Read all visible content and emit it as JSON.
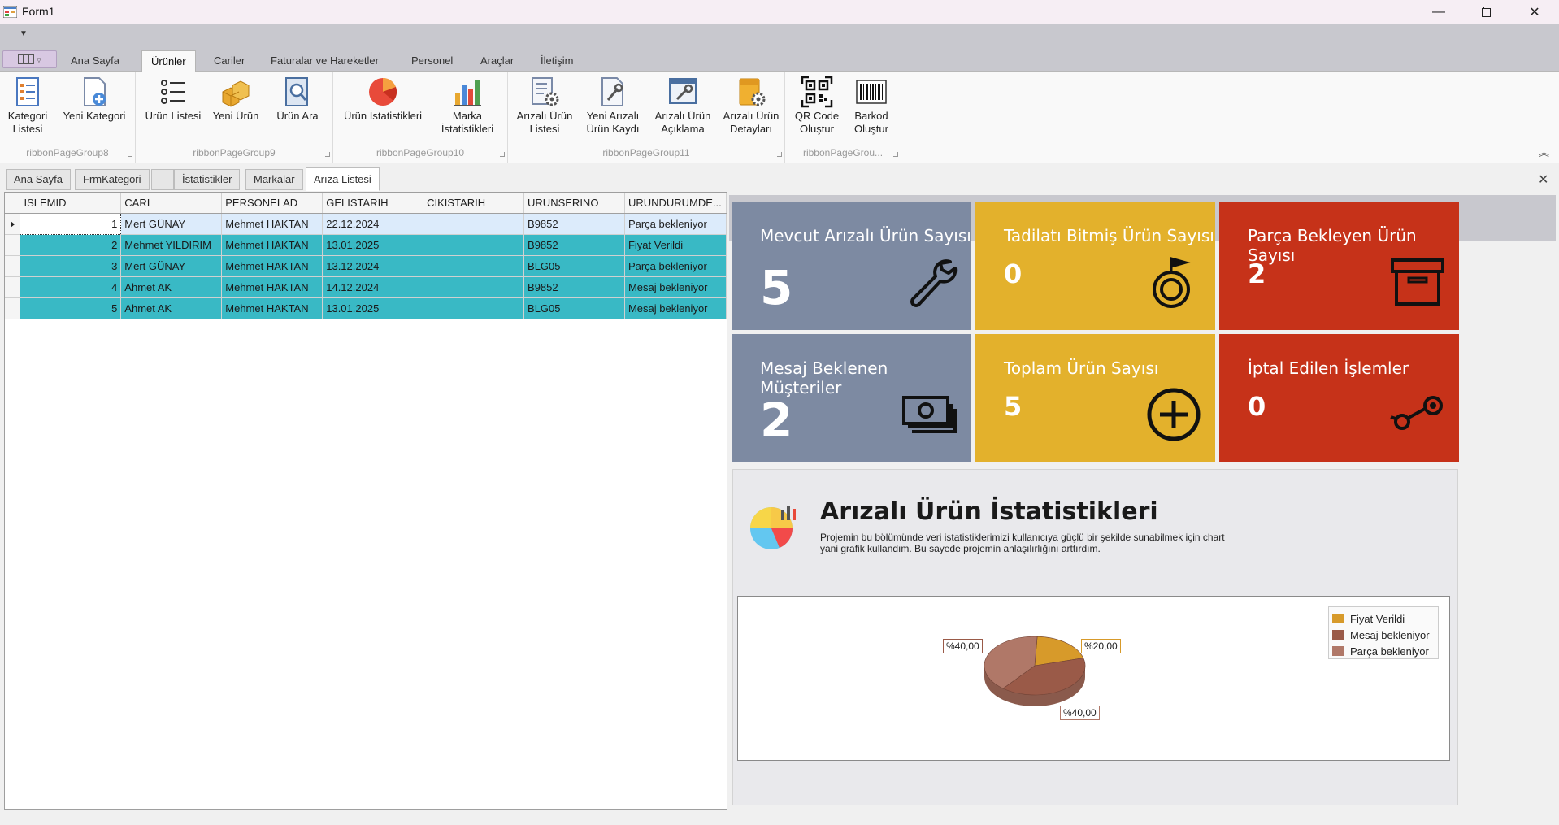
{
  "window": {
    "title": "Form1"
  },
  "ribbon": {
    "tabs": [
      "Ana Sayfa",
      "Ürünler",
      "Cariler",
      "Faturalar ve Hareketler",
      "Personel",
      "Araçlar",
      "İletişim"
    ],
    "active_tab": "Ürünler",
    "groups": [
      {
        "caption": "ribbonPageGroup8",
        "buttons": [
          "Kategori\nListesi",
          "Yeni Kategori"
        ]
      },
      {
        "caption": "ribbonPageGroup9",
        "buttons": [
          "Ürün Listesi",
          "Yeni Ürün",
          "Ürün Ara"
        ]
      },
      {
        "caption": "ribbonPageGroup10",
        "buttons": [
          "Ürün İstatistikleri",
          "Marka\nİstatistikleri"
        ]
      },
      {
        "caption": "ribbonPageGroup11",
        "buttons": [
          "Arızalı Ürün\nListesi",
          "Yeni Arızalı\nÜrün Kaydı",
          "Arızalı Ürün\nAçıklama",
          "Arızalı Ürün\nDetayları"
        ]
      },
      {
        "caption": "ribbonPageGrou...",
        "buttons": [
          "QR Code\nOluştur",
          "Barkod\nOluştur"
        ]
      }
    ]
  },
  "mdi_tabs": [
    "Ana Sayfa",
    "FrmKategori",
    "",
    "İstatistikler",
    "Markalar",
    "Arıza Listesi"
  ],
  "mdi_active": "Arıza Listesi",
  "grid": {
    "columns": [
      "ISLEMID",
      "CARI",
      "PERSONELAD",
      "GELISTARIH",
      "CIKISTARIH",
      "URUNSERINO",
      "URUNDURUMDE..."
    ],
    "rows": [
      {
        "id": "1",
        "cari": "Mert GÜNAY",
        "personel": "Mehmet  HAKTAN",
        "gelis": "22.12.2024",
        "cikis": "",
        "seri": "B9852",
        "durum": "Parça bekleniyor"
      },
      {
        "id": "2",
        "cari": "Mehmet YILDIRIM",
        "personel": "Mehmet  HAKTAN",
        "gelis": "13.01.2025",
        "cikis": "",
        "seri": "B9852",
        "durum": "Fiyat Verildi"
      },
      {
        "id": "3",
        "cari": "Mert GÜNAY",
        "personel": "Mehmet  HAKTAN",
        "gelis": "13.12.2024",
        "cikis": "",
        "seri": "BLG05",
        "durum": "Parça bekleniyor"
      },
      {
        "id": "4",
        "cari": "Ahmet AK",
        "personel": "Mehmet  HAKTAN",
        "gelis": "14.12.2024",
        "cikis": "",
        "seri": "B9852",
        "durum": "Mesaj bekleniyor"
      },
      {
        "id": "5",
        "cari": "Ahmet AK",
        "personel": "Mehmet  HAKTAN",
        "gelis": "13.01.2025",
        "cikis": "",
        "seri": "BLG05",
        "durum": "Mesaj bekleniyor"
      }
    ]
  },
  "tiles": [
    {
      "title": "Mevcut Arızalı Ürün Sayısı",
      "value": "5",
      "color": "#7d8aa2",
      "icon": "wrench-icon"
    },
    {
      "title": "Tadilatı Bitmiş Ürün Sayısı",
      "value": "0",
      "color": "#e3b12c",
      "icon": "medal-icon"
    },
    {
      "title": "Parça Bekleyen Ürün Sayısı",
      "value": "2",
      "color": "#c63219",
      "icon": "archive-box-icon"
    },
    {
      "title": "Mesaj Beklenen Müşteriler",
      "value": "2",
      "color": "#7d8aa2",
      "icon": "money-icon"
    },
    {
      "title": "Toplam Ürün Sayısı",
      "value": "5",
      "color": "#e3b12c",
      "icon": "plus-circle-icon"
    },
    {
      "title": "İptal Edilen İşlemler",
      "value": "0",
      "color": "#c63219",
      "icon": "steam-icon"
    }
  ],
  "stats": {
    "title": "Arızalı Ürün İstatistikleri",
    "description": "Projemin bu bölümünde veri istatistiklerimizi kullanıcıya güçlü bir şekilde sunabilmek için chart yani grafik kullandım. Bu sayede projemin anlaşılırlığını arttırdım."
  },
  "chart_data": {
    "type": "pie",
    "title": "",
    "labels": [
      "Fiyat Verildi",
      "Mesaj bekleniyor",
      "Parça bekleniyor"
    ],
    "values": [
      20,
      40,
      40
    ],
    "value_labels": [
      "%20,00",
      "%40,00",
      "%40,00"
    ],
    "colors": [
      "#d79a2a",
      "#9a5a48",
      "#b07868"
    ],
    "legend": "top-right"
  }
}
